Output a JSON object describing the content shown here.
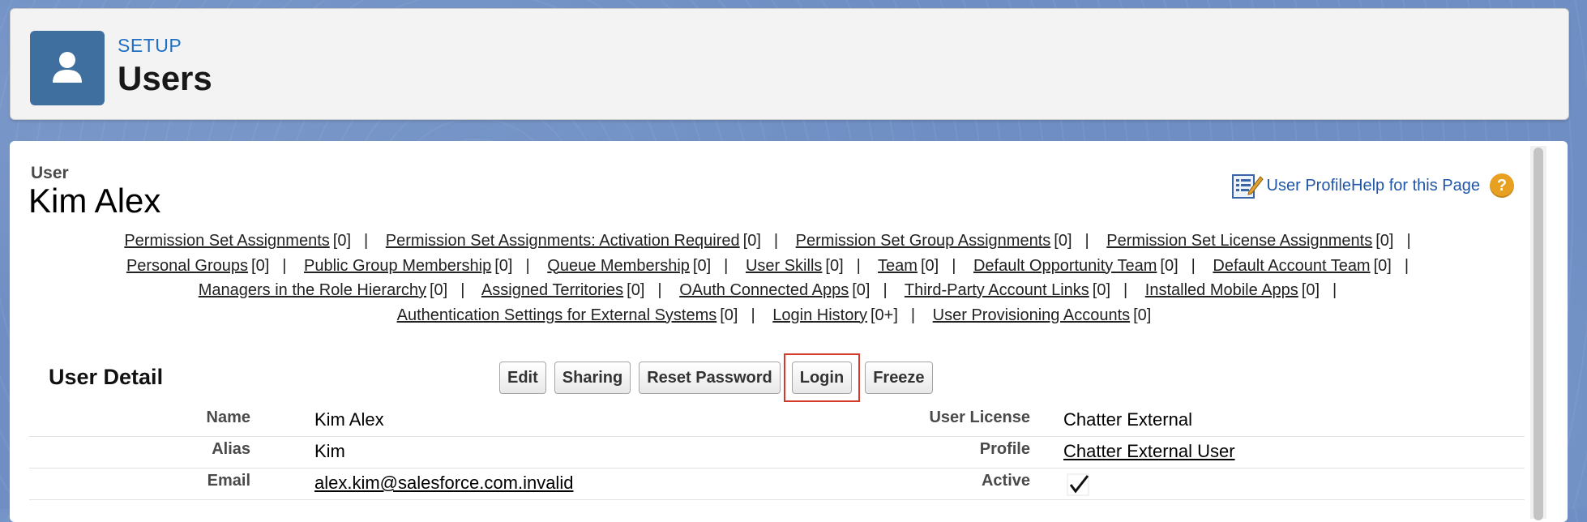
{
  "header": {
    "setup_label": "SETUP",
    "title": "Users",
    "icon": "user-icon",
    "icon_bg": "#3e6f9e"
  },
  "record": {
    "type_label": "User",
    "name": "Kim Alex"
  },
  "help": {
    "profile_link": "User ProfileHelp for this Page",
    "question_mark": "?"
  },
  "related_links": [
    [
      {
        "label": "Permission Set Assignments",
        "count": "[0]"
      },
      {
        "label": "Permission Set Assignments: Activation Required",
        "count": "[0]"
      },
      {
        "label": "Permission Set Group Assignments",
        "count": "[0]"
      },
      {
        "label": "Permission Set License Assignments",
        "count": "[0]"
      }
    ],
    [
      {
        "label": "Personal Groups",
        "count": "[0]"
      },
      {
        "label": "Public Group Membership",
        "count": "[0]"
      },
      {
        "label": "Queue Membership",
        "count": "[0]"
      },
      {
        "label": "User Skills",
        "count": "[0]"
      },
      {
        "label": "Team",
        "count": "[0]"
      },
      {
        "label": "Default Opportunity Team",
        "count": "[0]"
      },
      {
        "label": "Default Account Team",
        "count": "[0]"
      }
    ],
    [
      {
        "label": "Managers in the Role Hierarchy",
        "count": "[0]"
      },
      {
        "label": "Assigned Territories",
        "count": "[0]"
      },
      {
        "label": "OAuth Connected Apps",
        "count": "[0]"
      },
      {
        "label": "Third-Party Account Links",
        "count": "[0]"
      },
      {
        "label": "Installed Mobile Apps",
        "count": "[0]"
      }
    ],
    [
      {
        "label": "Authentication Settings for External Systems",
        "count": "[0]"
      },
      {
        "label": "Login History",
        "count": "[0+]"
      },
      {
        "label": "User Provisioning Accounts",
        "count": "[0]"
      }
    ]
  ],
  "separator": "|",
  "detail": {
    "title": "User Detail",
    "buttons": {
      "edit": "Edit",
      "sharing": "Sharing",
      "reset_password": "Reset Password",
      "login": "Login",
      "freeze": "Freeze"
    },
    "highlight_color": "#d63a2a",
    "rows": [
      {
        "left_label": "Name",
        "left_value": "Kim Alex",
        "right_label": "User License",
        "right_value": "Chatter External"
      },
      {
        "left_label": "Alias",
        "left_value": "Kim",
        "right_label": "Profile",
        "right_value": "Chatter External User"
      },
      {
        "left_label": "Email",
        "left_value": "alex.kim@salesforce.com.invalid",
        "right_label": "Active",
        "right_value_checked": true
      }
    ]
  }
}
